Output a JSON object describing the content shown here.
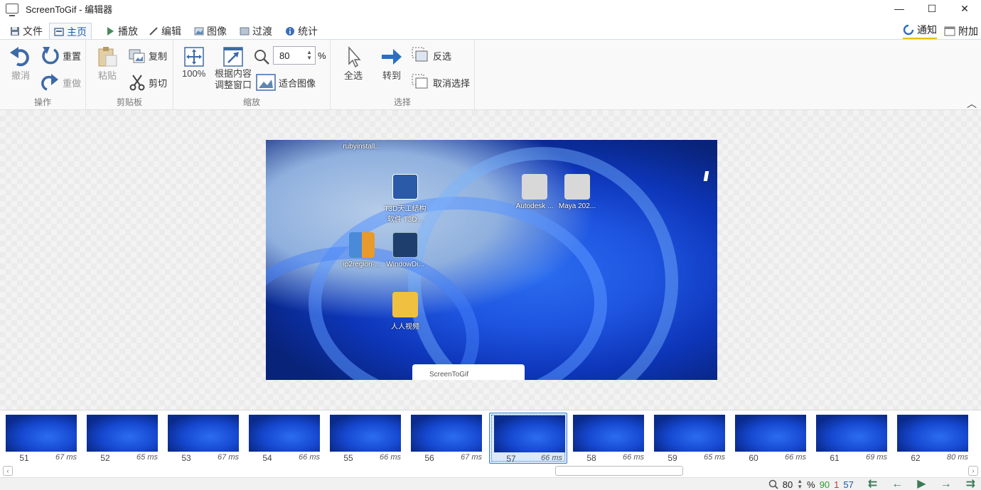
{
  "window": {
    "title": "ScreenToGif - 编辑器",
    "minimize": "—",
    "maximize": "☐",
    "close": "✕"
  },
  "tabs": [
    {
      "label": "文件",
      "icon": "save-icon"
    },
    {
      "label": "主页",
      "icon": "home-icon",
      "active": true
    },
    {
      "label": "播放",
      "icon": "play-icon"
    },
    {
      "label": "编辑",
      "icon": "pencil-icon"
    },
    {
      "label": "图像",
      "icon": "image-icon"
    },
    {
      "label": "过渡",
      "icon": "transition-icon"
    },
    {
      "label": "统计",
      "icon": "info-icon"
    }
  ],
  "right_tabs": [
    {
      "label": "通知",
      "icon": "refresh-icon",
      "active": true
    },
    {
      "label": "附加",
      "icon": "window-icon"
    }
  ],
  "ribbon": {
    "action": {
      "label": "操作",
      "undo": "撤消",
      "reset": "重置",
      "redo": "重做"
    },
    "clipboard": {
      "label": "剪贴板",
      "paste": "粘贴",
      "copy": "复制",
      "cut": "剪切"
    },
    "zoom": {
      "label": "缩放",
      "hundred": "100%",
      "fit_window_line1": "根据内容",
      "fit_window_line2": "调整窗口",
      "zoom_value": "80",
      "percent": "%",
      "fit_image": "适合图像"
    },
    "select": {
      "label": "选择",
      "select_all": "全选",
      "goto": "转到",
      "invert": "反选",
      "deselect": "取消选择"
    }
  },
  "desktop_icons": [
    {
      "label": "rubyinstall..."
    },
    {
      "label": "T3D天工结构\n软件 T3D..."
    },
    {
      "label": "Autodesk ..."
    },
    {
      "label": "Maya 202..."
    },
    {
      "label": "ip2region-..."
    },
    {
      "label": "WindowDi..."
    },
    {
      "label": "人人视频"
    }
  ],
  "mini_window_title": "ScreenToGif",
  "frames": [
    {
      "num": "51",
      "ms": "67 ms"
    },
    {
      "num": "52",
      "ms": "65 ms"
    },
    {
      "num": "53",
      "ms": "67 ms"
    },
    {
      "num": "54",
      "ms": "66 ms"
    },
    {
      "num": "55",
      "ms": "66 ms"
    },
    {
      "num": "56",
      "ms": "67 ms"
    },
    {
      "num": "57",
      "ms": "66 ms",
      "selected": true
    },
    {
      "num": "58",
      "ms": "66 ms"
    },
    {
      "num": "59",
      "ms": "65 ms"
    },
    {
      "num": "60",
      "ms": "66 ms"
    },
    {
      "num": "61",
      "ms": "69 ms"
    },
    {
      "num": "62",
      "ms": "80 ms"
    }
  ],
  "status": {
    "zoom": "80",
    "percent": "%",
    "total_frames": "90",
    "selected_count": "1",
    "current_frame": "57",
    "colors": {
      "total": "#2e9d2e",
      "selected": "#c0392b",
      "current": "#1a5aa8"
    }
  }
}
